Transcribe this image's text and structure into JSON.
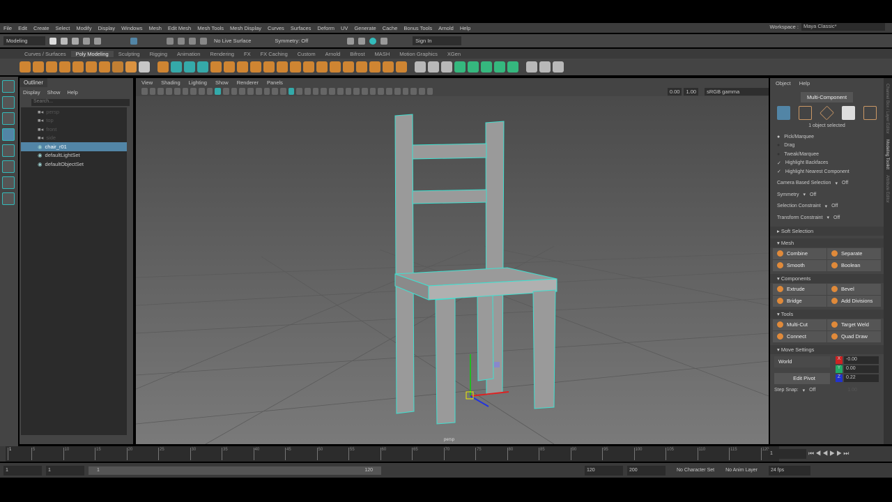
{
  "menu": [
    "File",
    "Edit",
    "Create",
    "Select",
    "Modify",
    "Display",
    "Windows",
    "Mesh",
    "Edit Mesh",
    "Mesh Tools",
    "Mesh Display",
    "Curves",
    "Surfaces",
    "Deform",
    "UV",
    "Generate",
    "Cache",
    "Bonus Tools",
    "Arnold",
    "Help"
  ],
  "workspace": {
    "label": "Workspace :",
    "value": "Maya Classic*"
  },
  "status": {
    "mode": "Modeling",
    "live_surface": "No Live Surface",
    "symmetry": "Symmetry: Off",
    "sign_in": "Sign In"
  },
  "shelf_tabs": [
    "Curves / Surfaces",
    "Poly Modeling",
    "Sculpting",
    "Rigging",
    "Animation",
    "Rendering",
    "FX",
    "FX Caching",
    "Custom",
    "Arnold",
    "Bifrost",
    "MASH",
    "Motion Graphics",
    "XGen"
  ],
  "shelf_active": 1,
  "outliner": {
    "title": "Outliner",
    "menu": [
      "Display",
      "Show",
      "Help"
    ],
    "search_placeholder": "Search...",
    "items": [
      {
        "label": "persp",
        "dim": true
      },
      {
        "label": "top",
        "dim": true
      },
      {
        "label": "front",
        "dim": true
      },
      {
        "label": "side",
        "dim": true
      },
      {
        "label": "chair_r01",
        "selected": true
      },
      {
        "label": "defaultLightSet"
      },
      {
        "label": "defaultObjectSet"
      }
    ]
  },
  "viewport": {
    "menu": [
      "View",
      "Shading",
      "Lighting",
      "Show",
      "Renderer",
      "Panels"
    ],
    "exposure": "0.00",
    "gamma": "1.00",
    "color_space": "sRGB gamma",
    "camera": "persp"
  },
  "toolkit": {
    "menu": [
      "Object",
      "Help"
    ],
    "mode": "Multi-Component",
    "selected": "1 object selected",
    "pick": [
      "Pick/Marquee",
      "Drag",
      "Tweak/Marquee"
    ],
    "checks": [
      "Highlight Backfaces",
      "Highlight Nearest Component"
    ],
    "camera_sel": "Camera Based Selection",
    "symmetry": "Symmetry",
    "sel_constraint": "Selection Constraint",
    "xform_constraint": "Transform Constraint",
    "off": "Off",
    "soft": "Soft Selection",
    "sections": [
      {
        "title": "Mesh",
        "buttons": [
          "Combine",
          "Separate",
          "Smooth",
          "Boolean"
        ]
      },
      {
        "title": "Components",
        "buttons": [
          "Extrude",
          "Bevel",
          "Bridge",
          "Add Divisions"
        ]
      },
      {
        "title": "Tools",
        "buttons": [
          "Multi-Cut",
          "Target Weld",
          "Connect",
          "Quad Draw"
        ]
      }
    ],
    "move": {
      "title": "Move Settings",
      "space": "World",
      "edit_pivot": "Edit Pivot",
      "x": "-0.00",
      "y": "0.00",
      "z": "0.22",
      "step_snap": "Step Snap:",
      "step_val": "Off",
      "step_num": "1.00"
    }
  },
  "side_tabs": [
    "Channel Box / Layer Editor",
    "Modeling Toolkit",
    "Attribute Editor"
  ],
  "timeline": {
    "ticks": [
      "5",
      "10",
      "15",
      "20",
      "25",
      "30",
      "35",
      "40",
      "45",
      "50",
      "55",
      "60",
      "65",
      "70",
      "75",
      "80",
      "85",
      "90",
      "95",
      "100",
      "105",
      "110",
      "115",
      "120"
    ],
    "current": "1",
    "current_field": "1"
  },
  "range": {
    "start": "1",
    "start2": "1",
    "bar_start": "1",
    "bar_end": "120",
    "end": "120",
    "end2": "200",
    "char_set": "No Character Set",
    "anim_layer": "No Anim Layer",
    "fps": "24 fps"
  },
  "colors": {
    "accent": "#5285a6",
    "wire": "#3fe0d0"
  }
}
